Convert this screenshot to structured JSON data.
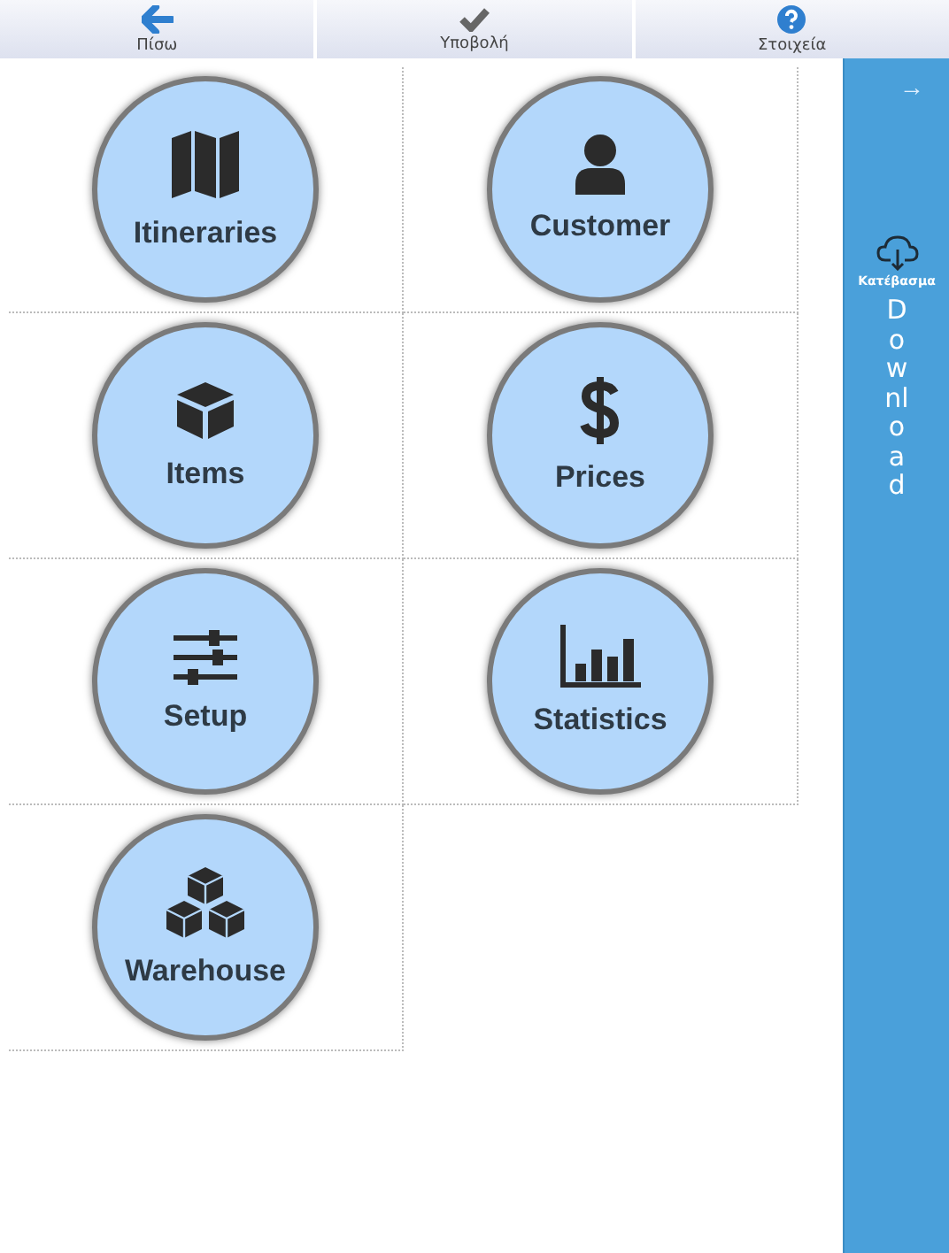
{
  "toolbar": [
    {
      "label": "Πίσω"
    },
    {
      "label": "Υποβολή"
    },
    {
      "label": "Στοιχεία"
    }
  ],
  "tiles": [
    {
      "label": "Itineraries"
    },
    {
      "label": "Customer"
    },
    {
      "label": "Items"
    },
    {
      "label": "Prices"
    },
    {
      "label": "Setup"
    },
    {
      "label": "Statistics"
    },
    {
      "label": "Warehouse"
    }
  ],
  "side_panel": {
    "arrow": "→",
    "download_label": "Κατέβασμα",
    "vertical_text": "Download"
  }
}
